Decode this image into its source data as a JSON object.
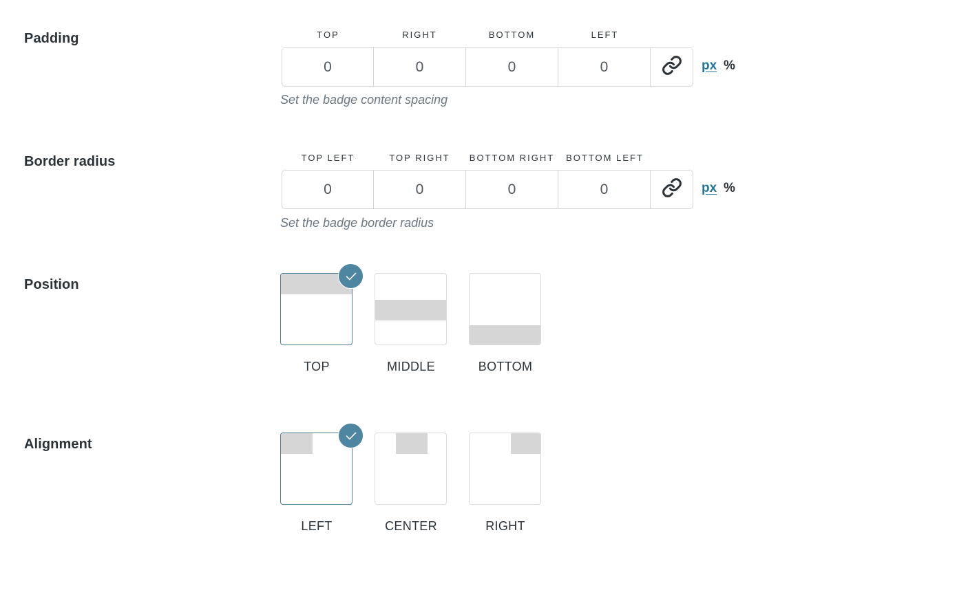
{
  "padding": {
    "label": "Padding",
    "headers": [
      "TOP",
      "RIGHT",
      "BOTTOM",
      "LEFT"
    ],
    "values": [
      "0",
      "0",
      "0",
      "0"
    ],
    "unit_px": "px",
    "unit_percent": "%",
    "selected_unit": "px",
    "help": "Set the badge content spacing",
    "link_icon": "link-icon"
  },
  "border_radius": {
    "label": "Border radius",
    "headers": [
      "TOP LEFT",
      "TOP RIGHT",
      "BOTTOM RIGHT",
      "BOTTOM LEFT"
    ],
    "values": [
      "0",
      "0",
      "0",
      "0"
    ],
    "unit_px": "px",
    "unit_percent": "%",
    "selected_unit": "px",
    "help": "Set the badge border radius",
    "link_icon": "link-icon"
  },
  "position": {
    "label": "Position",
    "options": [
      "TOP",
      "MIDDLE",
      "BOTTOM"
    ],
    "selected": "TOP"
  },
  "alignment": {
    "label": "Alignment",
    "options": [
      "LEFT",
      "CENTER",
      "RIGHT"
    ],
    "selected": "LEFT"
  },
  "colors": {
    "accent": "#4e85a0",
    "link": "#21759b",
    "bar": "#d6d6d6"
  }
}
